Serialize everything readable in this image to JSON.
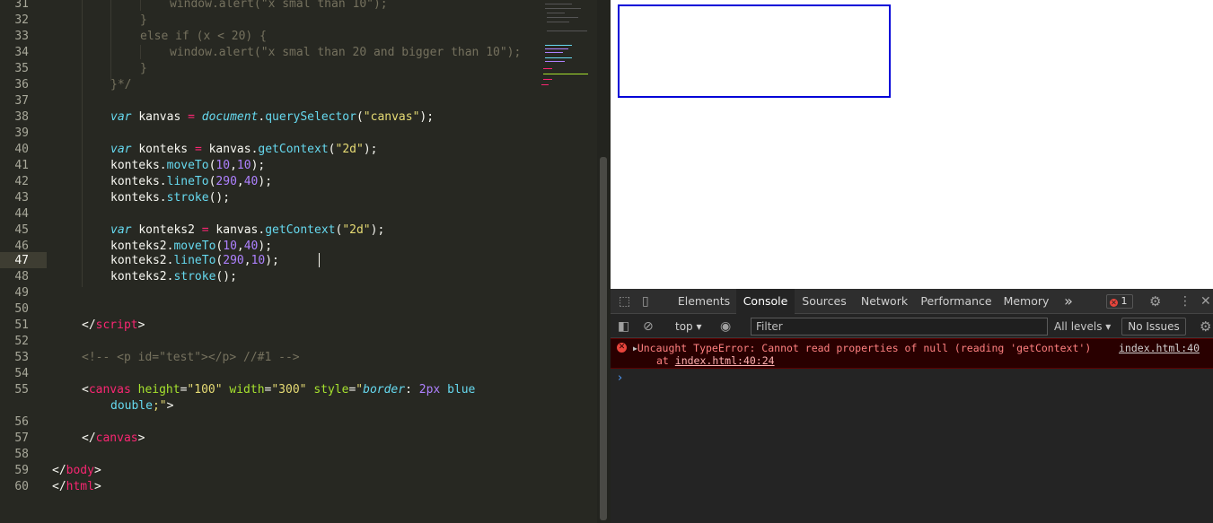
{
  "editor": {
    "line_numbers": [
      "31",
      "32",
      "33",
      "34",
      "35",
      "36",
      "37",
      "38",
      "39",
      "40",
      "41",
      "42",
      "43",
      "44",
      "45",
      "46",
      "47",
      "48",
      "49",
      "50",
      "51",
      "52",
      "53",
      "54",
      "55",
      "",
      "56",
      "57",
      "58",
      "59",
      "60"
    ],
    "current_line": "47",
    "code": {
      "l31": "window.alert(\"x smal than 10\");",
      "l32": "}",
      "l33_kw": "else if",
      "l33_rest": " (x < 20) {",
      "l34": "window.alert(\"x smal than 20 and bigger than 10\");",
      "l35": "}",
      "l36": "}*/",
      "var": "var",
      "kanvas": "kanvas",
      "konteks": "konteks",
      "konteks2": "konteks2",
      "document": "document",
      "querySelector": "querySelector",
      "getContext": "getContext",
      "moveTo": "moveTo",
      "lineTo": "lineTo",
      "stroke": "stroke",
      "str_canvas": "\"canvas\"",
      "str_2d": "\"2d\"",
      "n10": "10",
      "n40": "40",
      "n290": "290",
      "script_tag": "script",
      "comment": "<!-- <p id=\"test\"></p> //#1 -->",
      "canvas_tag": "canvas",
      "attr_height": "height",
      "val_height": "\"100\"",
      "attr_width": "width",
      "val_width": "\"300\"",
      "attr_style": "style",
      "style_prop": "border",
      "style_num": "2px",
      "style_color": "blue",
      "style_cont": "double;\"",
      "body_tag": "body",
      "html_tag": "html"
    }
  },
  "browser": {
    "canvas_border_color": "#0000d8"
  },
  "devtools": {
    "tabs": [
      "Elements",
      "Console",
      "Sources",
      "Network",
      "Performance",
      "Memory"
    ],
    "active_tab": "Console",
    "more_tabs": "»",
    "error_count": "1",
    "context": "top ▾",
    "filter_placeholder": "Filter",
    "levels": "All levels ▾",
    "issues": "No Issues",
    "error_message": "Uncaught TypeError: Cannot read properties of null (reading 'getContext')",
    "error_source": "index.html:40",
    "error_at_prefix": "at ",
    "error_at_link": "index.html:40:24",
    "prompt": "›"
  }
}
